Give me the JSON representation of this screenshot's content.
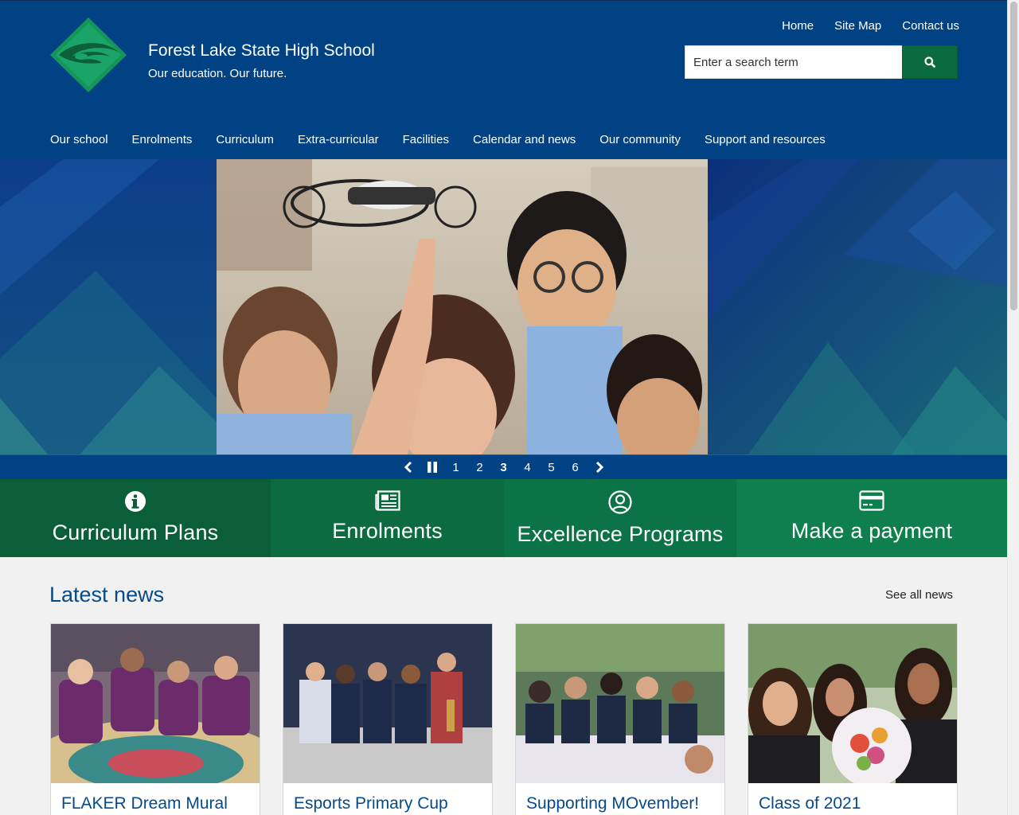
{
  "site": {
    "name": "Forest Lake State High School",
    "tagline": "Our education. Our future."
  },
  "utility_nav": [
    "Home",
    "Site Map",
    "Contact us"
  ],
  "search": {
    "placeholder": "Enter a search term"
  },
  "main_nav": [
    "Our school",
    "Enrolments",
    "Curriculum",
    "Extra-curricular",
    "Facilities",
    "Calendar and news",
    "Our community",
    "Support and resources"
  ],
  "carousel": {
    "slides": [
      "1",
      "2",
      "3",
      "4",
      "5",
      "6"
    ],
    "current": "3"
  },
  "quicklinks": [
    {
      "label": "Curriculum Plans",
      "icon": "info-icon"
    },
    {
      "label": "Enrolments",
      "icon": "newspaper-icon"
    },
    {
      "label": "Excellence Programs",
      "icon": "user-circle-icon"
    },
    {
      "label": "Make a payment",
      "icon": "credit-card-icon"
    }
  ],
  "news": {
    "heading": "Latest news",
    "see_all": "See all news",
    "items": [
      {
        "title": "FLAKER Dream Mural"
      },
      {
        "title": "Esports Primary Cup"
      },
      {
        "title": "Supporting MOvember!"
      },
      {
        "title": "Class of 2021"
      }
    ]
  },
  "colors": {
    "header_blue": "#004283",
    "accent_green": "#0c6b3e",
    "news_title_blue": "#064a8a"
  }
}
